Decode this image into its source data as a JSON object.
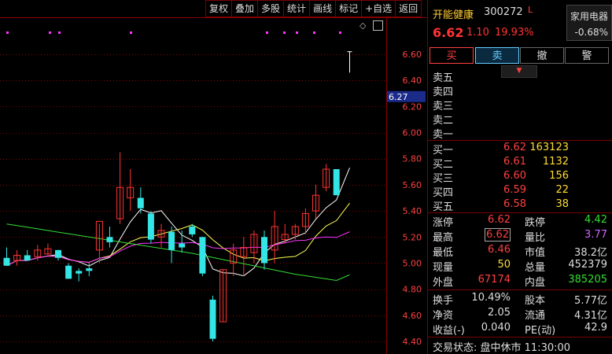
{
  "toolbar": [
    "复权",
    "叠加",
    "多股",
    "统计",
    "画线",
    "标记",
    "+自选",
    "返回"
  ],
  "chart": {
    "yaxis": {
      "ticks": [
        "6.60",
        "6.40",
        "6.20",
        "6.00",
        "5.80",
        "5.60",
        "5.40",
        "5.20",
        "5.00",
        "4.80",
        "4.60",
        "4.40"
      ],
      "cursor_price": "6.27"
    },
    "colors": {
      "up": "#ff3333",
      "down": "#33e5e5",
      "ma1": "#ffffff",
      "ma2": "#ffff55",
      "ma3": "#ff33ff",
      "ma4": "#33dd33",
      "grid": "#8b0000"
    }
  },
  "chart_data": {
    "type": "candlestick",
    "ylim": [
      4.4,
      6.6
    ],
    "candles": [
      {
        "o": 5.04,
        "h": 5.12,
        "l": 5.0,
        "c": 4.98
      },
      {
        "o": 5.02,
        "h": 5.1,
        "l": 4.98,
        "c": 5.06
      },
      {
        "o": 5.06,
        "h": 5.1,
        "l": 5.02,
        "c": 5.02
      },
      {
        "o": 5.05,
        "h": 5.14,
        "l": 5.02,
        "c": 5.1
      },
      {
        "o": 5.07,
        "h": 5.15,
        "l": 5.05,
        "c": 5.11
      },
      {
        "o": 5.1,
        "h": 5.08,
        "l": 5.02,
        "c": 5.04
      },
      {
        "o": 4.98,
        "h": 5.0,
        "l": 4.88,
        "c": 4.88
      },
      {
        "o": 4.94,
        "h": 4.96,
        "l": 4.86,
        "c": 4.92
      },
      {
        "o": 4.96,
        "h": 5.0,
        "l": 4.9,
        "c": 4.94
      },
      {
        "o": 5.1,
        "h": 5.3,
        "l": 5.0,
        "c": 5.32
      },
      {
        "o": 5.2,
        "h": 5.28,
        "l": 5.12,
        "c": 5.16
      },
      {
        "o": 5.34,
        "h": 5.85,
        "l": 5.3,
        "c": 5.58
      },
      {
        "o": 5.5,
        "h": 5.72,
        "l": 5.4,
        "c": 5.58
      },
      {
        "o": 5.5,
        "h": 5.58,
        "l": 5.38,
        "c": 5.42
      },
      {
        "o": 5.38,
        "h": 5.4,
        "l": 5.15,
        "c": 5.18
      },
      {
        "o": 5.2,
        "h": 5.3,
        "l": 5.12,
        "c": 5.25
      },
      {
        "o": 5.24,
        "h": 5.28,
        "l": 5.0,
        "c": 5.1
      },
      {
        "o": 5.15,
        "h": 5.25,
        "l": 5.08,
        "c": 5.12
      },
      {
        "o": 5.28,
        "h": 5.3,
        "l": 5.2,
        "c": 5.22
      },
      {
        "o": 5.2,
        "h": 5.2,
        "l": 4.9,
        "c": 4.92
      },
      {
        "o": 4.72,
        "h": 4.75,
        "l": 4.4,
        "c": 4.42
      },
      {
        "o": 4.55,
        "h": 4.95,
        "l": 4.55,
        "c": 4.95
      },
      {
        "o": 5.0,
        "h": 5.15,
        "l": 4.9,
        "c": 5.1
      },
      {
        "o": 5.05,
        "h": 5.2,
        "l": 4.9,
        "c": 5.12
      },
      {
        "o": 5.08,
        "h": 5.25,
        "l": 5.0,
        "c": 5.22
      },
      {
        "o": 5.2,
        "h": 5.25,
        "l": 4.95,
        "c": 5.0
      },
      {
        "o": 5.1,
        "h": 5.4,
        "l": 5.0,
        "c": 5.28
      },
      {
        "o": 5.18,
        "h": 5.3,
        "l": 5.15,
        "c": 5.22
      },
      {
        "o": 5.22,
        "h": 5.3,
        "l": 5.18,
        "c": 5.28
      },
      {
        "o": 5.28,
        "h": 5.42,
        "l": 5.22,
        "c": 5.38
      },
      {
        "o": 5.4,
        "h": 5.6,
        "l": 5.34,
        "c": 5.52
      },
      {
        "o": 5.58,
        "h": 5.76,
        "l": 5.55,
        "c": 5.72
      },
      {
        "o": 5.72,
        "h": 5.72,
        "l": 5.52,
        "c": 5.52
      }
    ],
    "today": {
      "h": 6.62,
      "l": 6.46
    }
  },
  "panel": {
    "stock_name": "开能健康",
    "stock_code": "300272",
    "margin_mark": "L",
    "sector": {
      "name": "家用电器",
      "change": "-0.68%"
    },
    "price": "6.62",
    "change": "1.10",
    "change_pct": "19.93%",
    "buttons": {
      "buy": "买",
      "sell": "卖",
      "cancel": "撤",
      "alert": "警"
    },
    "asks": [
      {
        "label": "卖五",
        "price": "",
        "vol": ""
      },
      {
        "label": "卖四",
        "price": "",
        "vol": ""
      },
      {
        "label": "卖三",
        "price": "",
        "vol": ""
      },
      {
        "label": "卖二",
        "price": "",
        "vol": ""
      },
      {
        "label": "卖一",
        "price": "",
        "vol": ""
      }
    ],
    "bids": [
      {
        "label": "买一",
        "price": "6.62",
        "vol": "163123"
      },
      {
        "label": "买二",
        "price": "6.61",
        "vol": "1132"
      },
      {
        "label": "买三",
        "price": "6.60",
        "vol": "156"
      },
      {
        "label": "买四",
        "price": "6.59",
        "vol": "22"
      },
      {
        "label": "买五",
        "price": "6.58",
        "vol": "38"
      }
    ],
    "stats1": [
      {
        "l1": "涨停",
        "v1": "6.62",
        "l2": "跌停",
        "v2": "4.42"
      },
      {
        "l1": "最高",
        "v1": "6.62",
        "l2": "量比",
        "v2": "3.77"
      },
      {
        "l1": "最低",
        "v1": "6.46",
        "l2": "市值",
        "v2": "38.2亿"
      },
      {
        "l1": "现量",
        "v1": "50",
        "l2": "总量",
        "v2": "452379"
      },
      {
        "l1": "外盘",
        "v1": "67174",
        "l2": "内盘",
        "v2": "385205"
      }
    ],
    "stats2": [
      {
        "l1": "换手",
        "v1": "10.49%",
        "l2": "股本",
        "v2": "5.77亿"
      },
      {
        "l1": "净资",
        "v1": "2.05",
        "l2": "流通",
        "v2": "4.31亿"
      },
      {
        "l1": "收益(-)",
        "v1": "0.040",
        "l2": "PE(动)",
        "v2": "42.9"
      }
    ],
    "status": "交易状态: 盘中休市 11:30:00"
  }
}
